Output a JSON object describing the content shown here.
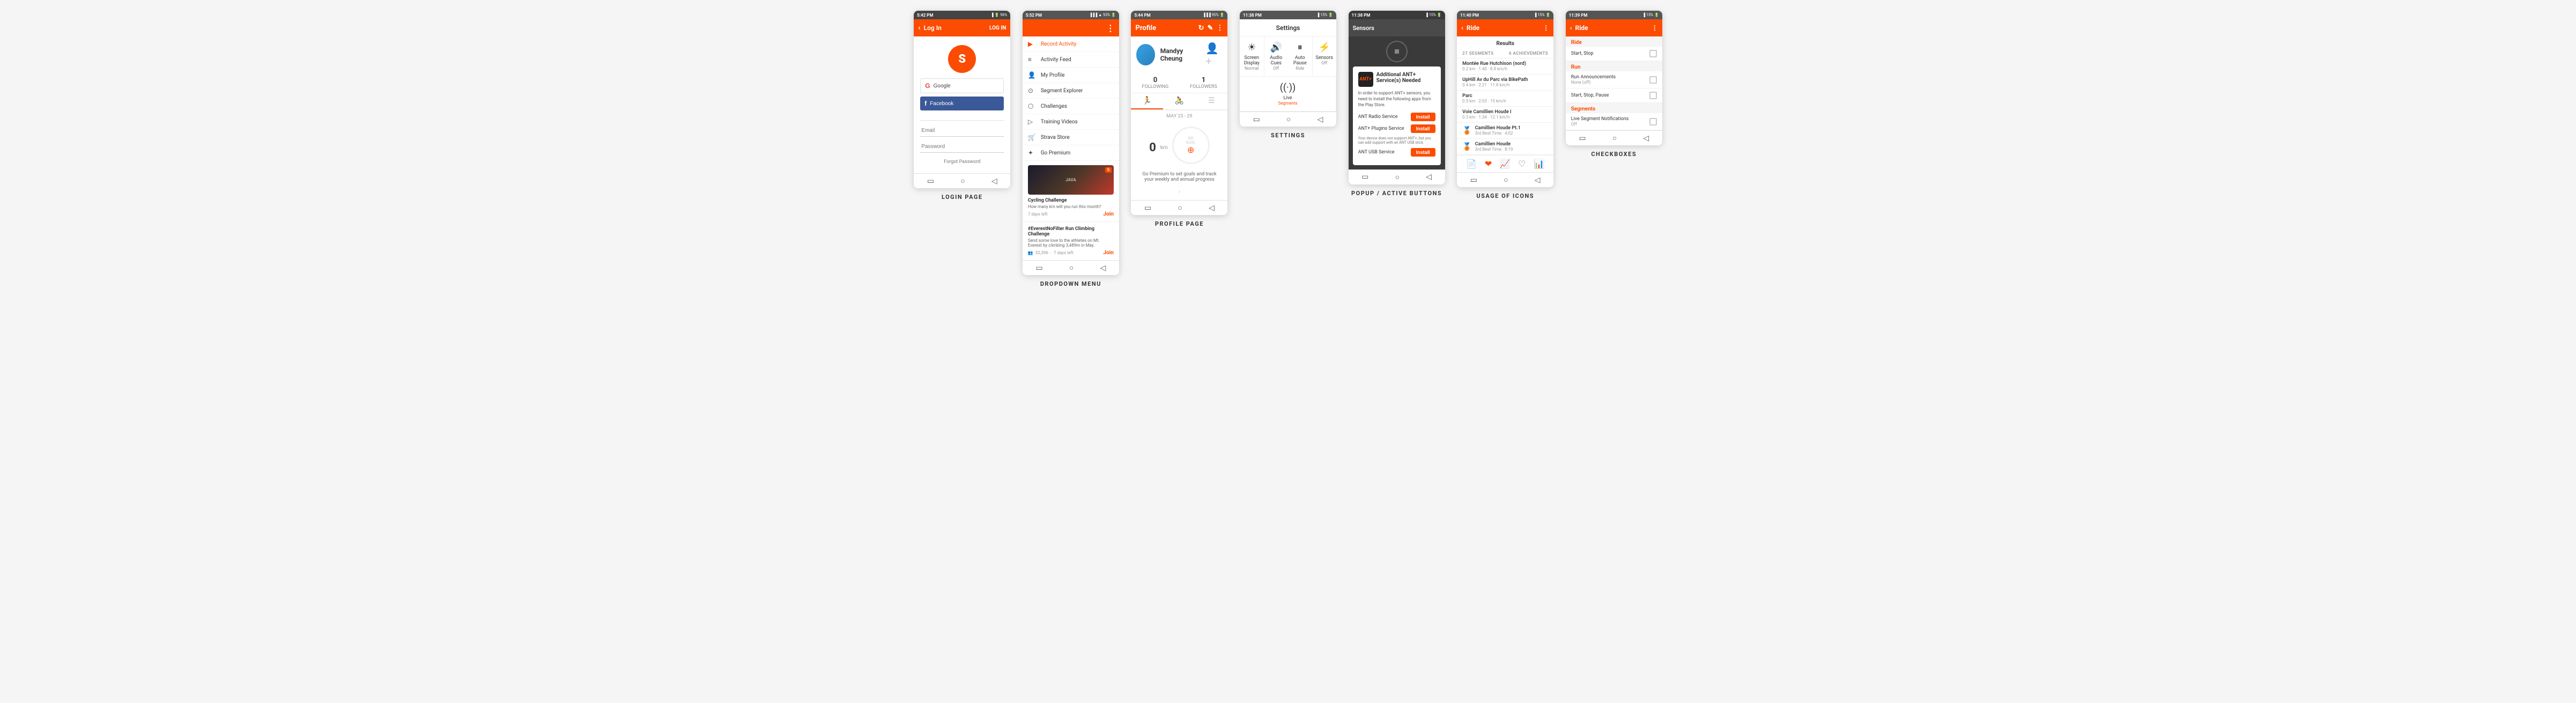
{
  "screens": {
    "login": {
      "label": "LOGIN PAGE",
      "statusBar": {
        "time": "5:42 PM",
        "signal": "96%"
      },
      "title": "Log In",
      "logInBtn": "LOG IN",
      "googleBtn": "Google",
      "facebookBtn": "Facebook",
      "emailPlaceholder": "Email",
      "passwordPlaceholder": "Password",
      "forgotPassword": "Forgot Password"
    },
    "dropdown": {
      "label": "DROPDOWN MENU",
      "statusBar": {
        "time": "5:52 PM",
        "signal": "93%"
      },
      "menuItems": [
        {
          "icon": "▶",
          "label": "Record Activity",
          "active": true
        },
        {
          "icon": "≡",
          "label": "Activity Feed"
        },
        {
          "icon": "👤",
          "label": "My Profile"
        },
        {
          "icon": "◎",
          "label": "Segment Explorer"
        },
        {
          "icon": "⬡",
          "label": "Challenges"
        },
        {
          "icon": "▷",
          "label": "Training Videos"
        },
        {
          "icon": "🛒",
          "label": "Strava Store"
        },
        {
          "icon": "✦",
          "label": "Go Premium"
        }
      ],
      "challengeTitle": "Cycling Challenge",
      "challengeSub": "How many km will you run this month?",
      "challengeDays": "7 days left",
      "joinBtn": "Join",
      "challenge2Title": "#EverestNoFilter Run Climbing Challenge",
      "challenge2Sub": "Send some love to the athletes on Mt. Everest by climbing 3,489m in May.",
      "challenge2Stats": "52,396",
      "challenge2Days": "7 days left",
      "joinBtn2": "Join"
    },
    "profile": {
      "label": "PROFILE PAGE",
      "statusBar": {
        "time": "5:44 PM",
        "signal": "95%"
      },
      "title": "Profile",
      "userName": "Mandyy Cheung",
      "following": "0",
      "followers": "1",
      "followingLabel": "FOLLOWING",
      "followersLabel": "FOLLOWERS",
      "weekLabel": "MAY 23 - 29",
      "distance": "0",
      "unit": "km",
      "noGoal": "NO GOAL",
      "premiumMsg": "Go Premium to set goals and track your weekly and annual progress"
    },
    "settings": {
      "label": "SETTINGS",
      "statusBar": {
        "time": "11:38 PM",
        "signal": "15%"
      },
      "title": "Settings",
      "items": [
        {
          "icon": "☀",
          "label": "Screen Display",
          "value": "Normal"
        },
        {
          "icon": "🔊",
          "label": "Audio Cues",
          "value": "Off"
        },
        {
          "icon": "⏸",
          "label": "Auto Pause",
          "value": "Ride"
        },
        {
          "icon": "⚡",
          "label": "Sensors",
          "value": "Off"
        },
        {
          "icon": "((o))",
          "label": "Live",
          "value": "Segments",
          "valueOrange": true
        }
      ]
    },
    "popup": {
      "label": "POPUP / ACTIVE BUTTONS",
      "statusBar": {
        "time": "11:38 PM",
        "signal": "15%"
      },
      "title": "Sensors",
      "popupTitle": "Additional ANT+ Service(s) Needed",
      "popupBody": "In order to support ANT+ sensors, you need to install the following apps from the Play Store.",
      "services": [
        {
          "name": "ANT Radio Service",
          "btn": "Install"
        },
        {
          "name": "ANT+ Plugins Service",
          "btn": "Install"
        },
        {
          "name": "ANT USB Service",
          "btn": "Install"
        }
      ],
      "footnote": "Your device does not support ANT+, but you can add support with an ANT USB stick."
    },
    "icons": {
      "label": "USAGE OF ICONS",
      "statusBar": {
        "time": "11:40 PM",
        "signal": "15%"
      },
      "title": "Ride",
      "resultsTitle": "Results",
      "segmentsLabel": "27 SEGMENTS",
      "achievementsLabel": "6 ACHIEVEMENTS",
      "segments": [
        {
          "name": "Montée Rue Hutchison (nord)",
          "detail": "0.2 km · 1:40 · 8.8 km/h",
          "medal": ""
        },
        {
          "name": "UpHill Av du Parc via BikePath",
          "detail": "0.4 km · 2:21 · 11.8 km/h",
          "medal": ""
        },
        {
          "name": "Parc",
          "detail": "0.5 km · 2:03 · 15 km/h",
          "medal": ""
        },
        {
          "name": "Voie Camillien Houde I",
          "detail": "0.3 km · 1:34 · 12.1 km/h",
          "medal": ""
        },
        {
          "name": "Camillien Houde Pt.1",
          "detail": "3rd Best Time · 4:02",
          "medal": "🥉"
        },
        {
          "name": "Camillien Houde",
          "detail": "3rd Best Time · 8:19",
          "medal": "🥉"
        }
      ],
      "toolbarIcons": [
        "📄",
        "❤",
        "📈",
        "♡",
        "📊"
      ]
    },
    "checkboxes": {
      "label": "CHECKBOXES",
      "statusBar": {
        "time": "11:39 PM",
        "signal": "15%"
      },
      "title": "Ride",
      "sections": [
        {
          "sectionLabel": "Ride",
          "items": [
            {
              "label": "Start, Stop",
              "value": "",
              "checked": false
            }
          ]
        },
        {
          "sectionLabel": "Run",
          "items": [
            {
              "label": "Run Announcements",
              "value": "None (off)",
              "checked": false
            },
            {
              "label": "Start, Stop, Pause",
              "value": "",
              "checked": false
            }
          ]
        },
        {
          "sectionLabel": "Segments",
          "items": [
            {
              "label": "Live Segment Notifications",
              "value": "Off",
              "checked": false
            }
          ]
        }
      ]
    }
  }
}
